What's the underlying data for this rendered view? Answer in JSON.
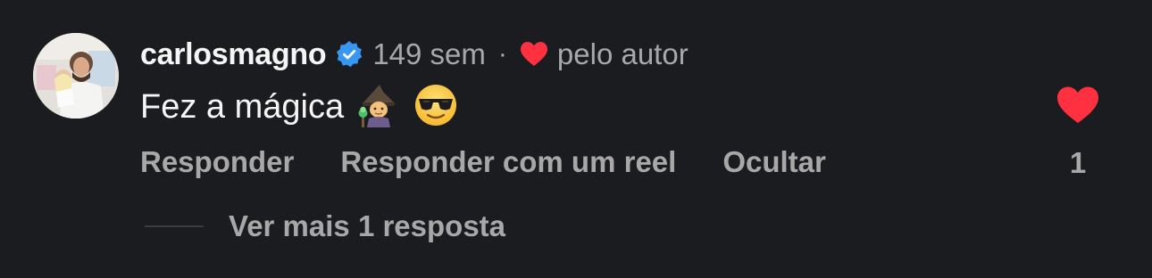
{
  "comment": {
    "username": "carlosmagno",
    "verified": true,
    "timestamp": "149 sem",
    "separator": "·",
    "liked_by_author_label": "pelo autor",
    "text": "Fez a mágica",
    "emojis": [
      "mage-emoji",
      "sunglasses-emoji"
    ],
    "like_count": "1",
    "liked": true
  },
  "actions": {
    "reply_label": "Responder",
    "reply_reel_label": "Responder com um reel",
    "hide_label": "Ocultar"
  },
  "replies": {
    "more_label": "Ver mais 1 resposta"
  },
  "colors": {
    "background": "#1a1c20",
    "primary_text": "#f5f5f5",
    "secondary_text": "#a8a8a8",
    "heart_red": "#ff3040",
    "verified_blue": "#3897f0"
  },
  "icons": {
    "verified": "verified-badge-icon",
    "author_like": "heart-icon",
    "like": "heart-filled-icon"
  }
}
